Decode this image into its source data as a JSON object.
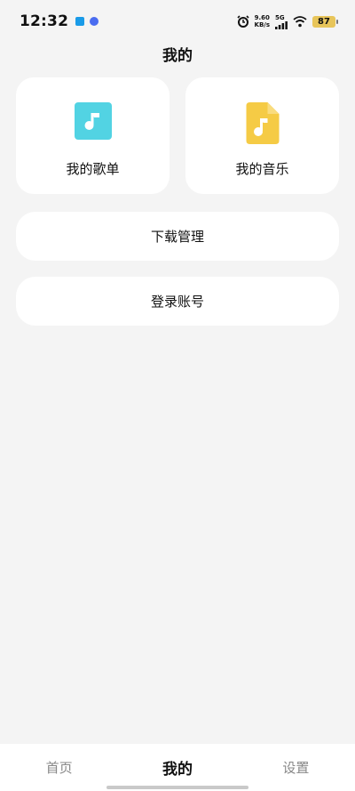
{
  "status_bar": {
    "time": "12:32",
    "speed_value": "9.60",
    "speed_unit": "KB/s",
    "network": "5G",
    "battery": "87"
  },
  "page": {
    "title": "我的"
  },
  "cards": {
    "my_playlist": {
      "label": "我的歌单",
      "icon": "music-note-icon",
      "color": "#52d3e3"
    },
    "my_music": {
      "label": "我的音乐",
      "icon": "music-file-icon",
      "color": "#f5cb45"
    }
  },
  "buttons": {
    "download": "下载管理",
    "login": "登录账号"
  },
  "nav": {
    "home": "首页",
    "mine": "我的",
    "settings": "设置",
    "active": "mine"
  }
}
